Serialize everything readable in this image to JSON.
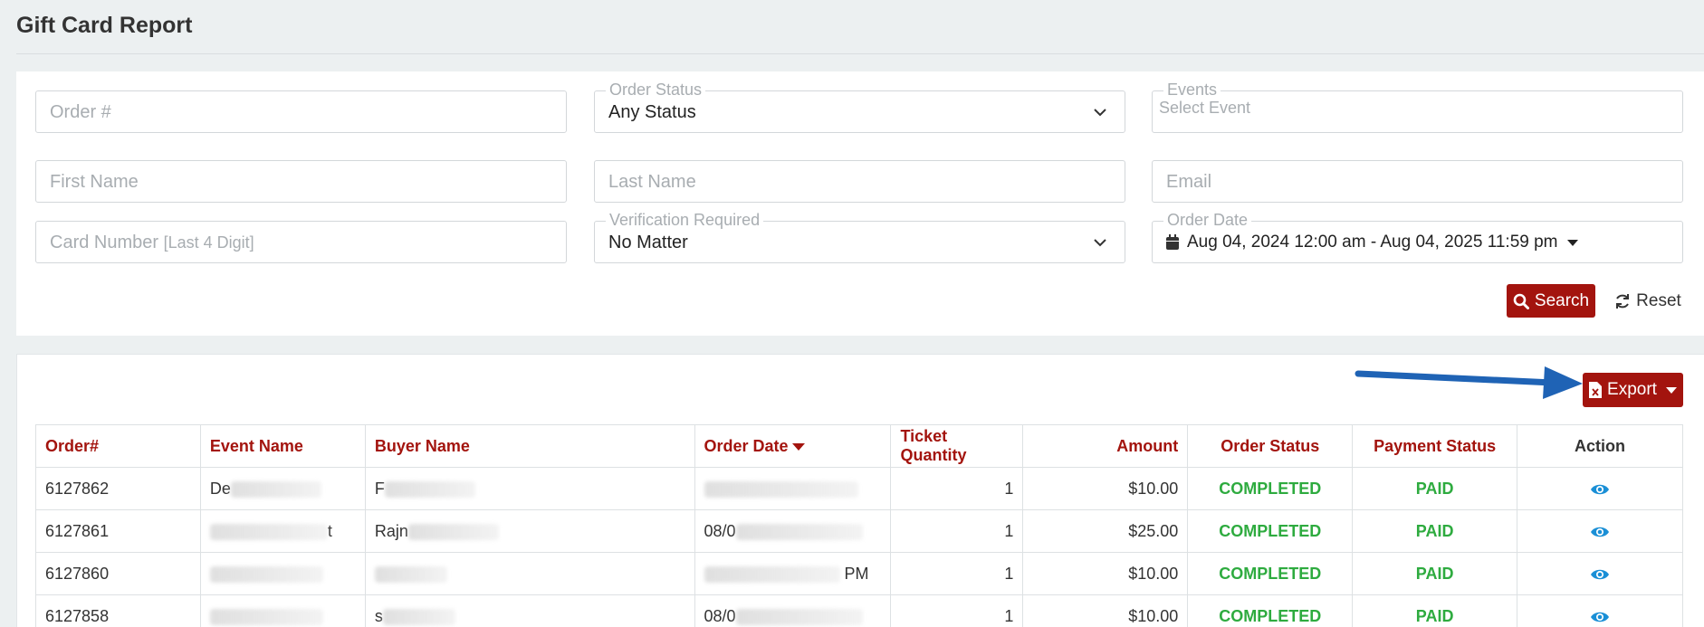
{
  "page": {
    "title": "Gift Card Report"
  },
  "filters": {
    "order_number": {
      "placeholder": "Order #"
    },
    "order_status": {
      "legend": "Order Status",
      "value": "Any Status"
    },
    "events": {
      "legend": "Events",
      "placeholder": "Select Event"
    },
    "first_name": {
      "placeholder": "First Name"
    },
    "last_name": {
      "placeholder": "Last Name"
    },
    "email": {
      "placeholder": "Email"
    },
    "card_number": {
      "placeholder": "Card Number",
      "placeholder_hint": "[Last 4 Digit]"
    },
    "verification": {
      "legend": "Verification Required",
      "value": "No Matter"
    },
    "order_date": {
      "legend": "Order Date",
      "value": "Aug 04, 2024 12:00 am - Aug 04, 2025 11:59 pm"
    },
    "search_label": "Search",
    "reset_label": "Reset"
  },
  "results": {
    "export_label": "Export",
    "columns": [
      "Order#",
      "Event Name",
      "Buyer Name",
      "Order Date",
      "Ticket Quantity",
      "Amount",
      "Order Status",
      "Payment Status",
      "Action"
    ],
    "rows": [
      {
        "order": "6127862",
        "event": "De",
        "event_tail": "",
        "buyer": "F",
        "date": "",
        "date_tail": "",
        "qty": "1",
        "amount": "$10.00",
        "order_status": "COMPLETED",
        "payment_status": "PAID"
      },
      {
        "order": "6127861",
        "event": "",
        "event_tail": "t",
        "buyer": "Rajn",
        "date": "08/0",
        "date_tail": "",
        "qty": "1",
        "amount": "$25.00",
        "order_status": "COMPLETED",
        "payment_status": "PAID"
      },
      {
        "order": "6127860",
        "event": "",
        "event_tail": "",
        "buyer": "",
        "date": "",
        "date_tail": "PM",
        "qty": "1",
        "amount": "$10.00",
        "order_status": "COMPLETED",
        "payment_status": "PAID"
      },
      {
        "order": "6127858",
        "event": "",
        "event_tail": "",
        "buyer": "s",
        "date": "08/0",
        "date_tail": "",
        "qty": "1",
        "amount": "$10.00",
        "order_status": "COMPLETED",
        "payment_status": "PAID"
      }
    ]
  },
  "colors": {
    "accent": "#a3140e",
    "success": "#2eab3f",
    "info": "#1a8fd6",
    "annotation_arrow": "#1f63b5"
  },
  "icons": {
    "search": "search-icon",
    "reset": "refresh-icon",
    "export": "file-excel-icon",
    "calendar": "calendar-icon",
    "view": "eye-icon"
  }
}
